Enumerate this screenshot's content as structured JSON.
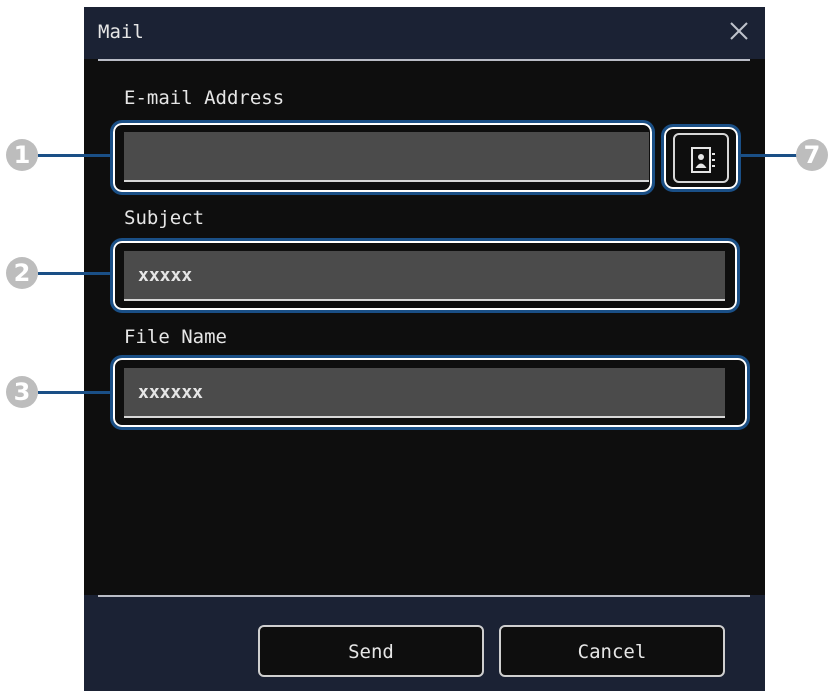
{
  "dialog": {
    "title": "Mail",
    "close_icon": "close-icon"
  },
  "fields": {
    "email": {
      "label": "E-mail Address",
      "value": ""
    },
    "subject": {
      "label": "Subject",
      "value": "xxxxx"
    },
    "file_name": {
      "label": "File Name",
      "value": "xxxxxx"
    }
  },
  "address_book_icon": "address-book-icon",
  "buttons": {
    "send": "Send",
    "cancel": "Cancel"
  },
  "callouts": {
    "c1": "1",
    "c2": "2",
    "c3": "3",
    "c7": "7"
  },
  "colors": {
    "background": "#0e0e0e",
    "titlebar": "#1b2234",
    "input": "#4b4b4b",
    "callout_border": "#1a4f86",
    "callout_number": "#bdbdbd"
  }
}
